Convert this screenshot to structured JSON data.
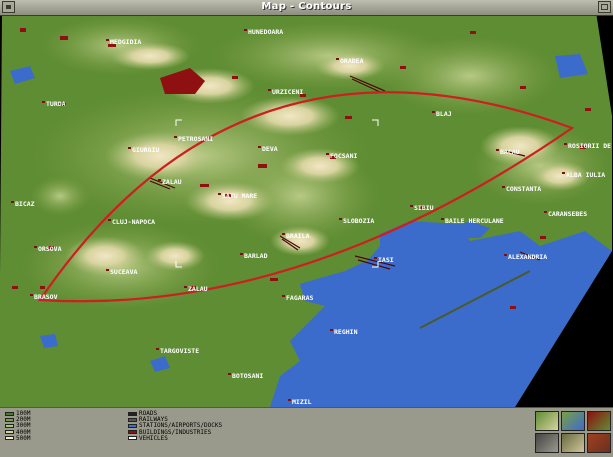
{
  "window": {
    "title": "Map - Contours"
  },
  "colors": {
    "water": "#3c6ccb",
    "lowland": "#5b8a2f",
    "midland": "#9bb96a",
    "highland": "#e6dcae",
    "route": "#cc1f1f",
    "industry": "#8e1010",
    "frame": "#9a9a8c"
  },
  "towns": [
    {
      "name": "MEDGIDIA"
    },
    {
      "name": "HUNEDOARA"
    },
    {
      "name": "ORADEA"
    },
    {
      "name": "TURDA"
    },
    {
      "name": "URZICENI"
    },
    {
      "name": "BLAJ"
    },
    {
      "name": "PETROSANI"
    },
    {
      "name": "GIURGIU"
    },
    {
      "name": "FOCSANI"
    },
    {
      "name": "BACAU"
    },
    {
      "name": "DEVA"
    },
    {
      "name": "ZALAU"
    },
    {
      "name": "SATU MARE"
    },
    {
      "name": "BICAZ"
    },
    {
      "name": "CLUJ-NAPOCA"
    },
    {
      "name": "BRAILA"
    },
    {
      "name": "SLOBOZIA"
    },
    {
      "name": "SIBIU"
    },
    {
      "name": "BAILE HERCULANE"
    },
    {
      "name": "CONSTANTA"
    },
    {
      "name": "ALBA IULIA"
    },
    {
      "name": "ROSIORII DE VEDE"
    },
    {
      "name": "CARANSEBES"
    },
    {
      "name": "ORSOVA"
    },
    {
      "name": "BARLAD"
    },
    {
      "name": "IASI"
    },
    {
      "name": "SUCEAVA"
    },
    {
      "name": "ALEXANDRIA"
    },
    {
      "name": "ZALAU"
    },
    {
      "name": "FAGARAS"
    },
    {
      "name": "BRASOV"
    },
    {
      "name": "REGHIN"
    },
    {
      "name": "TARGOVISTE"
    },
    {
      "name": "BOTOSANI"
    },
    {
      "name": "MIZIL"
    }
  ],
  "legend": {
    "contours": [
      {
        "label": "100M",
        "color": "#4c7d26"
      },
      {
        "label": "200M",
        "color": "#78a042"
      },
      {
        "label": "300M",
        "color": "#a9c47a"
      },
      {
        "label": "400M",
        "color": "#d2d4a0"
      },
      {
        "label": "500M",
        "color": "#f0e8c8"
      }
    ],
    "features": [
      {
        "label": "ROADS",
        "color": "#222222"
      },
      {
        "label": "RAILWAYS",
        "color": "#555555"
      },
      {
        "label": "STATIONS/AIRPORTS/DOCKS",
        "color": "#3c6ccb"
      },
      {
        "label": "BUILDINGS/INDUSTRIES",
        "color": "#8e1010"
      },
      {
        "label": "VEHICLES",
        "color": "#ffffff"
      }
    ]
  },
  "map_buttons": [
    {
      "icon": "terrain-icon"
    },
    {
      "icon": "contours-icon"
    },
    {
      "icon": "industry-icon"
    },
    {
      "icon": "vehicles-icon"
    },
    {
      "icon": "town-icon"
    },
    {
      "icon": "player-icon"
    }
  ]
}
